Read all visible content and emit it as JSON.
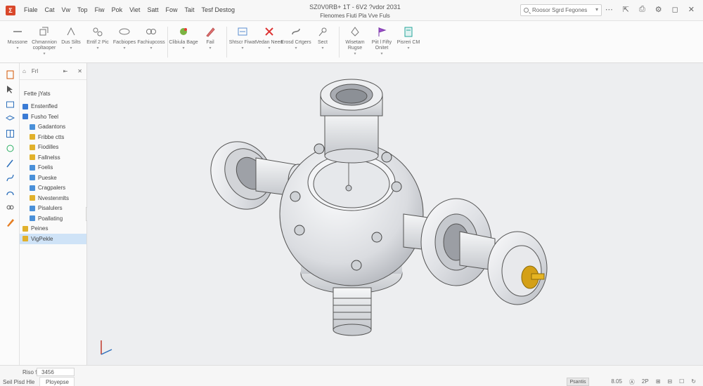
{
  "titlebar": {
    "menu": [
      "Fiale",
      "Cat",
      "Vw",
      "Top",
      "Fiw",
      "Pok",
      "Viet",
      "Satt",
      "Fow",
      "Tait",
      "Tesf Destog"
    ],
    "doc_title": "SZ0V0RB+ 1T - 6V2 ?vdor 2031",
    "doc_subtitle": "Flenomes Fiuti Pla Vve Fuls",
    "search_placeholder": "Roosor Sgrd Fegones",
    "window_icons": [
      "⋯",
      "⇱",
      "⎙",
      "⚙",
      "◻",
      "✕"
    ]
  },
  "ribbon": {
    "groups": [
      {
        "buttons": [
          {
            "label": "Mussone",
            "icon": "dash-icon"
          },
          {
            "label": "Chmannion copltaoper",
            "icon": "extrude-icon"
          },
          {
            "label": "Dus Silts",
            "icon": "revolve-icon"
          },
          {
            "label": "Entif 2 Pic",
            "icon": "pattern-icon"
          },
          {
            "label": "Facbiopes",
            "icon": "fillet-icon"
          },
          {
            "label": "Fachiupcoss",
            "icon": "chain-icon"
          }
        ]
      },
      {
        "buttons": [
          {
            "label": "Clibiula Bage",
            "icon": "material-icon"
          },
          {
            "label": "Fail",
            "icon": "pen-icon"
          }
        ]
      },
      {
        "buttons": [
          {
            "label": "Shtscr Fiwat",
            "icon": "measure-icon"
          },
          {
            "label": "Vedan Neen",
            "icon": "delete-icon"
          },
          {
            "label": "Erosd Crtgers",
            "icon": "link-icon"
          },
          {
            "label": "Sect",
            "icon": "section-icon"
          }
        ]
      },
      {
        "buttons": [
          {
            "label": "Wisetam Rugse",
            "icon": "plane-icon"
          },
          {
            "label": "Piit l Fifty Onitet",
            "icon": "flag-icon"
          },
          {
            "label": "Pisreri CM",
            "icon": "document-icon"
          }
        ]
      }
    ]
  },
  "tools": [
    "doc-icon",
    "cursor-icon",
    "box-icon",
    "tray-icon",
    "grid-icon",
    "sketch-icon",
    "line-icon",
    "spline-icon",
    "curve-icon",
    "chain-icon",
    "pen-icon"
  ],
  "panel": {
    "tabs": [
      "Frl"
    ],
    "title": "Fette jYats",
    "items": [
      {
        "label": "Enstenfled",
        "depth": 0,
        "color": "#3a7bd5"
      },
      {
        "label": "Fusho Teel",
        "depth": 0,
        "color": "#3a7bd5"
      },
      {
        "label": "Gadantons",
        "depth": 1,
        "color": "#4a90d9"
      },
      {
        "label": "Fribbe ctts",
        "depth": 1,
        "color": "#e1b12c"
      },
      {
        "label": "Fiodilles",
        "depth": 1,
        "color": "#e1b12c"
      },
      {
        "label": "Fallnelss",
        "depth": 1,
        "color": "#e1b12c"
      },
      {
        "label": "Foelis",
        "depth": 1,
        "color": "#4a90d9"
      },
      {
        "label": "Pueske",
        "depth": 1,
        "color": "#4a90d9"
      },
      {
        "label": "Cragpalers",
        "depth": 1,
        "color": "#4a90d9"
      },
      {
        "label": "Nvestenmlts",
        "depth": 1,
        "color": "#e1b12c"
      },
      {
        "label": "Pisalulers",
        "depth": 1,
        "color": "#4a90d9"
      },
      {
        "label": "Poallating",
        "depth": 1,
        "color": "#4a90d9"
      },
      {
        "label": "Peines",
        "depth": 0,
        "color": "#e1b12c"
      },
      {
        "label": "VigPekle",
        "depth": 0,
        "color": "#e1b12c",
        "selected": true
      }
    ]
  },
  "statusbar": {
    "left_label": "Riso 9D",
    "field_value": "3456",
    "bottom_left": "Seil Pisd Hle",
    "tab_label": "Ployepse",
    "badge": "Psantis",
    "right": [
      "8.05",
      "Ⓐ",
      "2P",
      "⊞",
      "⊟",
      "☐",
      "↻"
    ]
  }
}
